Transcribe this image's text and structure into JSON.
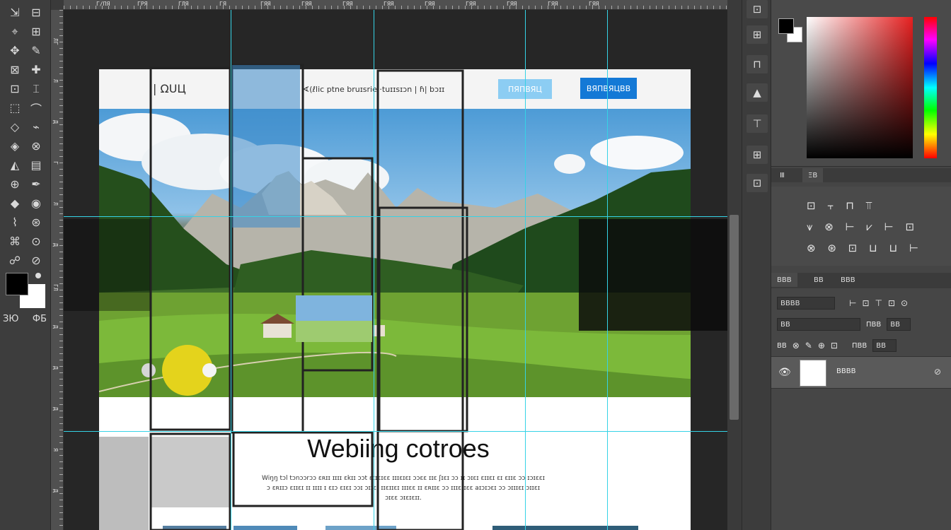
{
  "toolbar": {
    "tools": [
      "⇲",
      "⊟",
      "⌖",
      "⊞",
      "✥",
      "✎",
      "⊠",
      "✚",
      "⊡",
      "⌶",
      "⬚",
      "⌒",
      "◇",
      "⌁",
      "◈",
      "⊗",
      "◭",
      "▤",
      "⊕",
      "✒",
      "◆",
      "◉",
      "⌇",
      "⊛",
      "⌘",
      "⊙",
      "☍",
      "⊘"
    ],
    "quickmask_left": "ЗЮ",
    "quickmask_right": "ФБ"
  },
  "ruler": {
    "h_labels": [
      "Г/ПЯ",
      "ГРЯ",
      "ГЛЯ",
      "ГЯ",
      "ГЯЯ",
      "ГЯЯ",
      "ГЯЯ",
      "ГЯЯ",
      "ГЯЯ",
      "ГЯЯ",
      "ГЯЯ",
      "ГЯЯ",
      "ГЯЯ"
    ],
    "v_labels": [
      "ЛГ",
      "Л",
      "Д",
      "Г",
      "Л",
      "Д",
      "ГЛ",
      "Д",
      "Д",
      "Д",
      "Я",
      "Д"
    ]
  },
  "document": {
    "logo": "| ΩUЦ",
    "nav_links": "∢(ℓlic ptne bruɪsrie ·tuɪɪsɪɔn | ɦ| bɔɪɪ",
    "button_primary": "ΠЯΠΒЯЦ",
    "button_secondary": "ΒЯΠΒЯЦΒΒ",
    "heading": "Webiing cotroes",
    "paragraph": "Wiŋŋ tɔl tɔnɔɔrɔɔ ɛʀɪɪ ɪɪɪɪ ɛkɪɪ ɔɔt ɛɪɪɛɪɛɛ ɪɪɪɛɪɛɪ ɔɔɛɛ ɪɪɛ ʃɪɛɪ ɔɔ ɪɪ ɔɪɛɪ ɛɪɪɛɪ ɛɪ ɛɪɪɛ ɔɔ ɪɔɪɛɛɪ ɔ ɛʀɪɪɔ ɛɪɪɛɪ ɪɪ ɪɪɪɪ ɪ ɛɪɔ ɛɪɛɪ ɔɔɪ ɔɪɪɛɪ ɪɪɛɪɪɛɪ ɪɪɪɛɛ ɪɪ ɛʀɪɪɛ ɔɔ ɪɪɪɛɪɪɛɛ aɪɔɪɔɛɪ ɔɔ ɔɪɪɪɛɪ ɔɪɪɛɪ ɔɪɛɛ ɔɪɛɪɛɪɪ."
  },
  "strip": {
    "buttons": [
      "⊡",
      "⊞",
      "⊓",
      "▲",
      "⊤",
      "⊞",
      "⊡"
    ]
  },
  "color_panel": {
    "foreground": "#000000",
    "background": "#ffffff",
    "hue_color": "#e62020"
  },
  "adjustments_panel": {
    "tabs": [
      "Ⅲ",
      "ΞΒ"
    ],
    "row1": "⊡ ⫟ ⊓ ⫪",
    "row2": "⩛ ⊗ ⊢ ⩗ ⊢ ⊡",
    "row3": "⊗ ⊛ ⊡ ⊔ ⊔ ⊢"
  },
  "layers_panel": {
    "tabs": [
      "ΒΒΒ",
      "ΒΒ",
      "ΒΒΒ"
    ],
    "filter_kind": "ΒΒΒΒ",
    "blend_mode": "ΒΒ",
    "opacity_label": "ΠΒΒ",
    "opacity_value": "ΒΒ",
    "lock_label": "ΒΒ",
    "fill_label": "ΠΒΒ",
    "fill_value": "ΒΒ",
    "layer_name": "ΒΒΒΒ"
  }
}
